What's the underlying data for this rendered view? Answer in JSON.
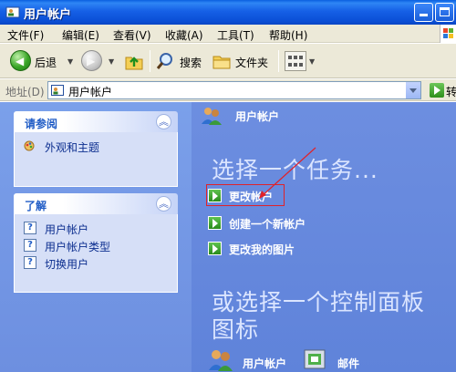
{
  "window": {
    "title": "用户帐户"
  },
  "menu": [
    "文件(F)",
    "编辑(E)",
    "查看(V)",
    "收藏(A)",
    "工具(T)",
    "帮助(H)"
  ],
  "toolbar": {
    "back_label": "后退",
    "search_label": "搜索",
    "folders_label": "文件夹"
  },
  "address": {
    "label": "地址(D)",
    "value": "用户帐户",
    "go_label": "转"
  },
  "left_boxes": [
    {
      "title": "请参阅",
      "items": [
        {
          "label": "外观和主题",
          "icon": "appearance-icon"
        }
      ]
    },
    {
      "title": "了解",
      "items": [
        {
          "label": "用户帐户",
          "icon": "help-icon"
        },
        {
          "label": "用户帐户类型",
          "icon": "help-icon"
        },
        {
          "label": "切换用户",
          "icon": "help-icon"
        }
      ]
    }
  ],
  "main": {
    "title": "用户帐户",
    "task_heading": "选择一个任务...",
    "tasks": [
      "更改帐户",
      "创建一个新帐户",
      "更改我的图片"
    ],
    "cp_heading_line1": "或选择一个控制面板",
    "cp_heading_line2": "图标",
    "cp_icons": [
      {
        "label": "用户帐户",
        "icon": "users-icon"
      },
      {
        "label": "邮件",
        "icon": "mail-icon"
      }
    ]
  },
  "colors": {
    "titlebar": "#0b4fd6",
    "left_pane": "#7ba0ea",
    "right_pane": "#6b8ee0",
    "highlight": "#e0222a"
  }
}
